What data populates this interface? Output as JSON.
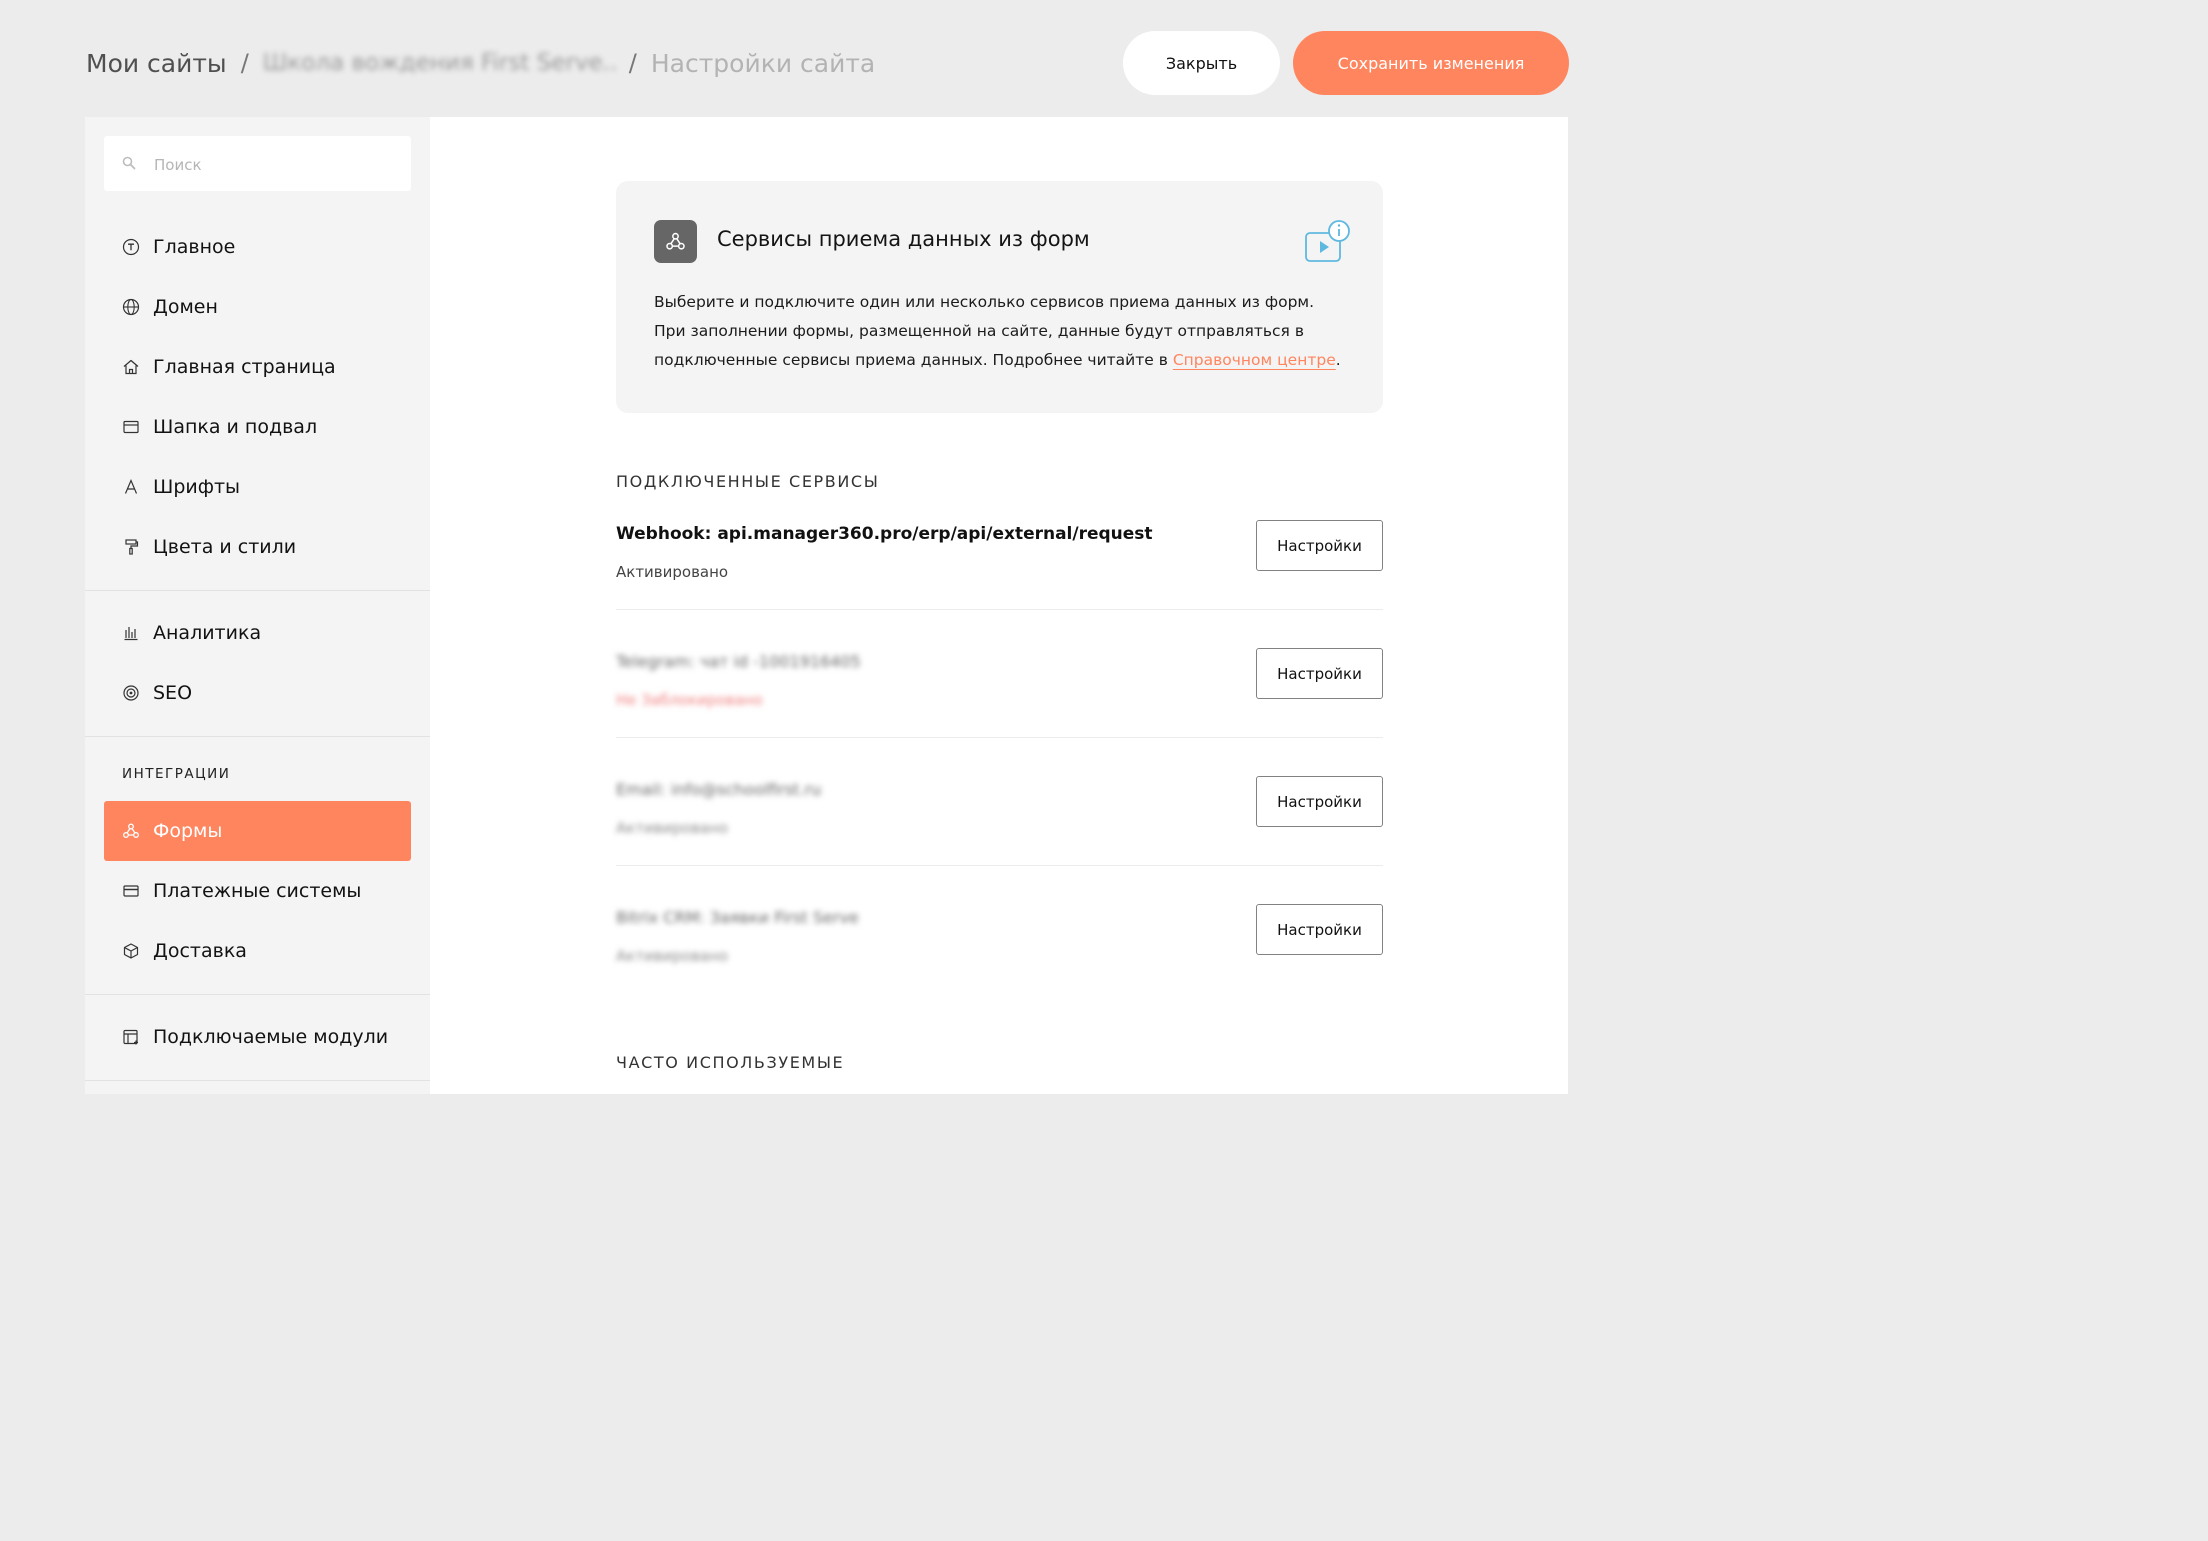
{
  "header": {
    "breadcrumb": {
      "root": "Мои сайты",
      "site": "Школа вождения First Serve...",
      "current": "Настройки сайта",
      "separator": "/"
    },
    "close_label": "Закрыть",
    "save_label": "Сохранить изменения",
    "accent_color": "#ff855f"
  },
  "sidebar": {
    "search": {
      "placeholder": "Поиск",
      "value": ""
    },
    "items": [
      {
        "label": "Главное",
        "icon": "main-settings-icon"
      },
      {
        "label": "Домен",
        "icon": "globe-icon"
      },
      {
        "label": "Главная страница",
        "icon": "home-icon"
      },
      {
        "label": "Шапка и подвал",
        "icon": "header-footer-icon"
      },
      {
        "label": "Шрифты",
        "icon": "font-icon"
      },
      {
        "label": "Цвета и стили",
        "icon": "paint-roller-icon"
      },
      {
        "label": "Аналитика",
        "icon": "bar-chart-icon"
      },
      {
        "label": "SEO",
        "icon": "target-icon"
      }
    ],
    "integrations_label": "ИНТЕГРАЦИИ",
    "integrations": [
      {
        "label": "Формы",
        "icon": "webhook-icon",
        "active": true
      },
      {
        "label": "Платежные системы",
        "icon": "credit-card-icon"
      },
      {
        "label": "Доставка",
        "icon": "package-icon"
      }
    ],
    "modules": {
      "label": "Подключаемые модули",
      "icon": "plugin-icon"
    }
  },
  "main": {
    "info_card": {
      "title": "Сервисы приема данных из форм",
      "icon": "webhook-icon",
      "video_icon": "video-info-icon",
      "description": "Выберите и подключите один или несколько сервисов приема данных из форм. При заполнении формы, размещенной на сайте, данные будут отправляться в подключенные сервисы приема данных. Подробнее читайте в ",
      "link_text": "Справочном центре",
      "description_end": "."
    },
    "connected_heading": "ПОДКЛЮЧЕННЫЕ СЕРВИСЫ",
    "services": [
      {
        "title": "Webhook: api.manager360.pro/erp/api/external/request",
        "status": "Активировано",
        "button": "Настройки"
      },
      {
        "title": "Telegram: чат id -1001916405",
        "status": "Не Заблокировано",
        "button": "Настройки"
      },
      {
        "title": "Email: info@schoolfirst.ru",
        "status": "Активировано",
        "button": "Настройки"
      },
      {
        "title": "Bitrix CRM: Заявки First Serve",
        "status": "Активировано",
        "button": "Настройки"
      }
    ],
    "frequent_heading": "ЧАСТО ИСПОЛЬЗУЕМЫЕ"
  }
}
